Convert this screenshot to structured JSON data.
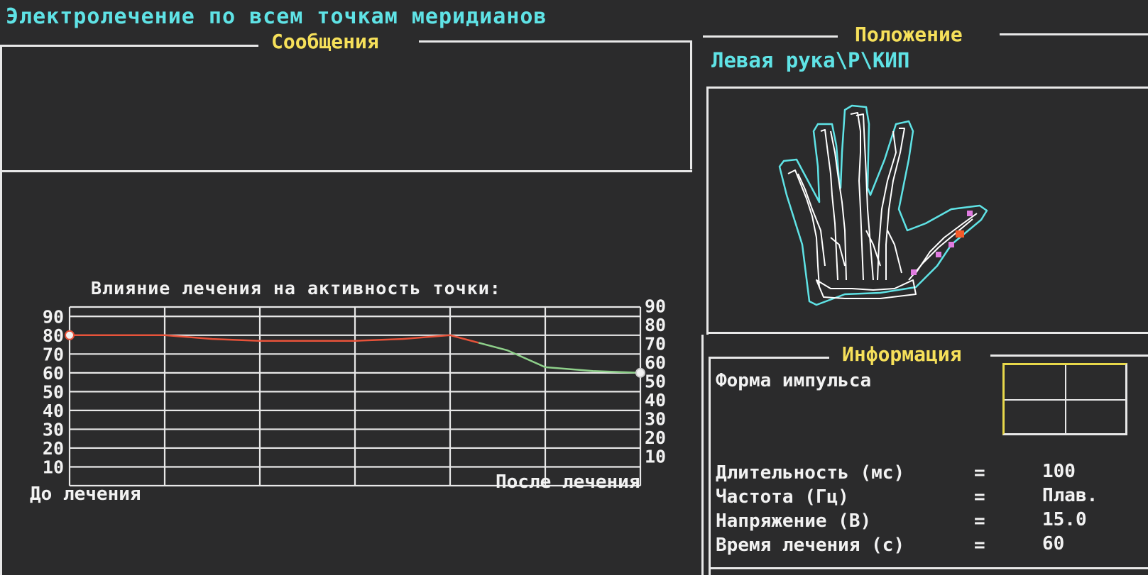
{
  "window": {
    "title": "Электролечение по всем точкам меридианов"
  },
  "messages_panel": {
    "legend": "Сообщения",
    "text": ""
  },
  "position_panel": {
    "legend": "Положение",
    "path": "Левая рука\\Р\\КИП",
    "image_icon": "left-hand-skeleton-icon"
  },
  "chart": {
    "title": "Влияние лечения на активность точки:",
    "left_axis_caption": "До лечения",
    "right_axis_caption": "После лечения"
  },
  "chart_data": {
    "type": "line",
    "title": "Влияние лечения на активность точки:",
    "xlabel": "До лечения",
    "x2label": "После лечения",
    "ylim": [
      0,
      100
    ],
    "yticks": [
      10,
      20,
      30,
      40,
      50,
      60,
      70,
      80,
      90
    ],
    "grid": true,
    "x": [
      0,
      0.5,
      1,
      1.5,
      2,
      2.5,
      3,
      3.5,
      4,
      4.5,
      5,
      5.5,
      6
    ],
    "series": [
      {
        "color": "#e8533a",
        "x": [
          0,
          0.5,
          1,
          1.5,
          2,
          2.5,
          3,
          3.5,
          4,
          4.3
        ],
        "values": [
          80,
          80,
          80,
          78,
          77,
          77,
          77,
          78,
          80,
          76
        ]
      },
      {
        "color": "#8ed08a",
        "x": [
          4.3,
          4.6,
          5,
          5.5,
          6
        ],
        "values": [
          76,
          72,
          63,
          61,
          60
        ]
      }
    ],
    "start_value": 80,
    "end_value": 60
  },
  "info_panel": {
    "legend": "Информация",
    "pulse_shape_label": "Форма импульса",
    "rows": [
      {
        "label": "Длительность (мс)",
        "eq": "=",
        "value": "100"
      },
      {
        "label": "Частота (Гц)",
        "eq": "=",
        "value": "Плав."
      },
      {
        "label": "Напряжение (В)",
        "eq": "=",
        "value": "15.0"
      },
      {
        "label": "Время лечения (с)",
        "eq": "=",
        "value": "60"
      }
    ]
  },
  "colors": {
    "background": "#2b2b2c",
    "title_cyan": "#5fe3e6",
    "legend_yellow": "#f6e05a",
    "line_red": "#e8533a",
    "line_green": "#8ed08a",
    "point_magenta": "#e07be0",
    "point_active": "#f25b2a"
  }
}
